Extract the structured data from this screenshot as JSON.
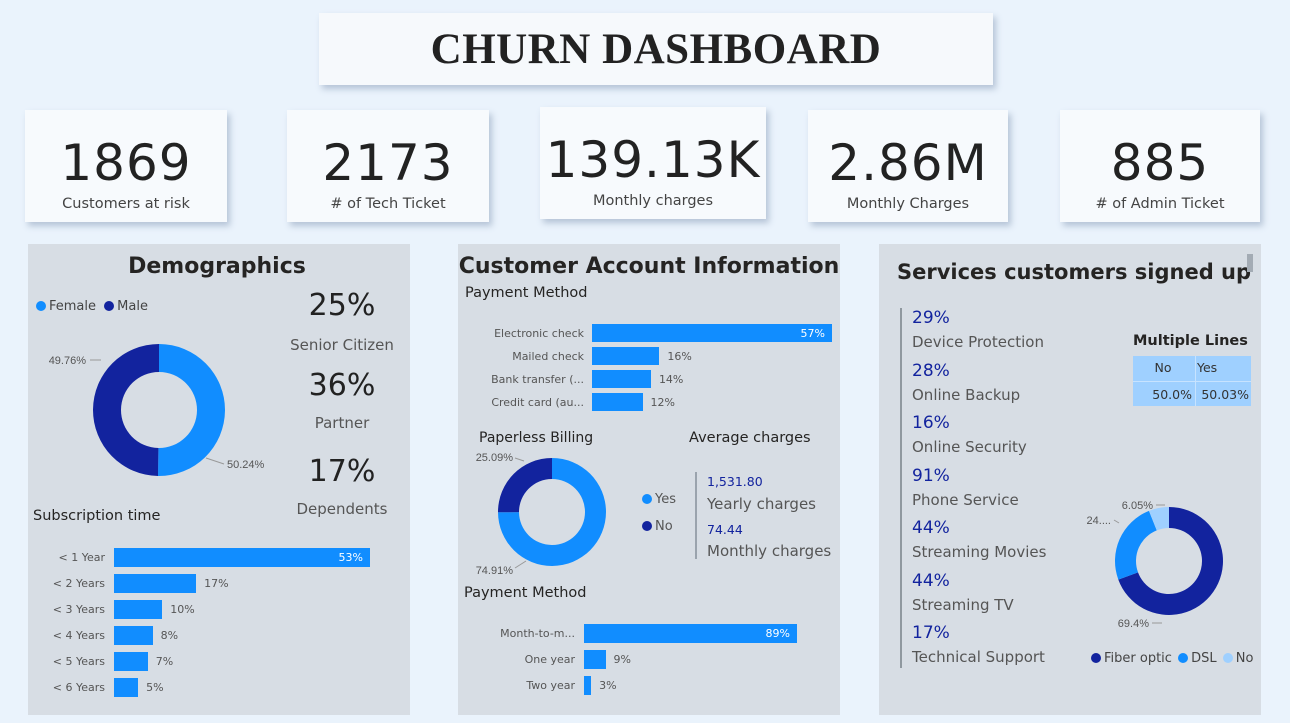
{
  "title": "CHURN DASHBOARD",
  "colors": {
    "accent": "#118dff",
    "dark": "#12239e",
    "light": "#9fd0ff",
    "background": "#eaf3fc"
  },
  "kpis": [
    {
      "value": "1869",
      "label": "Customers at risk"
    },
    {
      "value": "2173",
      "label": "# of Tech Ticket"
    },
    {
      "value": "139.13K",
      "label": "Monthly charges"
    },
    {
      "value": "2.86M",
      "label": "Monthly Charges"
    },
    {
      "value": "885",
      "label": "# of Admin Ticket"
    }
  ],
  "demographics": {
    "title": "Demographics",
    "legend": {
      "female": "Female",
      "male": "Male"
    },
    "donut_labels": {
      "male": "49.76%",
      "female": "50.24%"
    },
    "stats": [
      {
        "value": "25%",
        "label": "Senior Citizen"
      },
      {
        "value": "36%",
        "label": "Partner"
      },
      {
        "value": "17%",
        "label": "Dependents"
      }
    ],
    "subscription_title": "Subscription time"
  },
  "account": {
    "title": "Customer Account Information",
    "payment_title": "Payment Method",
    "paperless_title": "Paperless Billing",
    "avg_title": "Average charges",
    "paperless_labels": {
      "no": "25.09%",
      "yes": "74.91%"
    },
    "paperless_legend": {
      "yes": "Yes",
      "no": "No"
    },
    "yearly_value": "1,531.80",
    "yearly_label": "Yearly charges",
    "monthly_value": "74.44",
    "monthly_label": "Monthly charges",
    "contract_title": "Payment Method"
  },
  "services": {
    "title": "Services customers signed up",
    "items": [
      {
        "value": "29%",
        "label": "Device Protection"
      },
      {
        "value": "28%",
        "label": "Online Backup"
      },
      {
        "value": "16%",
        "label": "Online Security"
      },
      {
        "value": "91%",
        "label": "Phone Service"
      },
      {
        "value": "44%",
        "label": "Streaming Movies"
      },
      {
        "value": "44%",
        "label": "Streaming TV"
      },
      {
        "value": "17%",
        "label": "Technical Support"
      }
    ],
    "multiple_lines": {
      "title": "Multiple Lines",
      "headers": [
        "No",
        "Yes"
      ],
      "values": [
        "50.0%",
        "50.03%"
      ]
    },
    "internet_labels": {
      "no": "6.05%",
      "dsl": "24....",
      "fiber": "69.4%"
    },
    "internet_legend": {
      "fiber": "Fiber optic",
      "dsl": "DSL",
      "no": "No"
    }
  },
  "chart_data": [
    {
      "type": "pie",
      "title": "",
      "labels": [
        "Female",
        "Male"
      ],
      "values": [
        50.24,
        49.76
      ],
      "hole": true
    },
    {
      "type": "bar",
      "orientation": "horizontal",
      "title": "Subscription time",
      "categories": [
        "< 1 Year",
        "< 2 Years",
        "< 3 Years",
        "< 4 Years",
        "< 5 Years",
        "< 6 Years"
      ],
      "values": [
        53,
        17,
        10,
        8,
        7,
        5
      ],
      "labels": [
        "53%",
        "17%",
        "10%",
        "8%",
        "7%",
        "5%"
      ],
      "max": 53
    },
    {
      "type": "bar",
      "orientation": "horizontal",
      "title": "Payment Method",
      "categories": [
        "Electronic check",
        "Mailed check",
        "Bank transfer (...",
        "Credit card (au..."
      ],
      "values": [
        57,
        16,
        14,
        12
      ],
      "labels": [
        "57%",
        "16%",
        "14%",
        "12%"
      ],
      "max": 57
    },
    {
      "type": "pie",
      "title": "Paperless Billing",
      "labels": [
        "Yes",
        "No"
      ],
      "values": [
        74.91,
        25.09
      ],
      "hole": true
    },
    {
      "type": "bar",
      "orientation": "horizontal",
      "title": "Payment Method",
      "categories": [
        "Month-to-m...",
        "One year",
        "Two year"
      ],
      "values": [
        89,
        9,
        3
      ],
      "labels": [
        "89%",
        "9%",
        "3%"
      ],
      "max": 89
    },
    {
      "type": "pie",
      "title": "",
      "labels": [
        "Fiber optic",
        "DSL",
        "No"
      ],
      "values": [
        69.4,
        24.55,
        6.05
      ],
      "hole": true
    }
  ]
}
